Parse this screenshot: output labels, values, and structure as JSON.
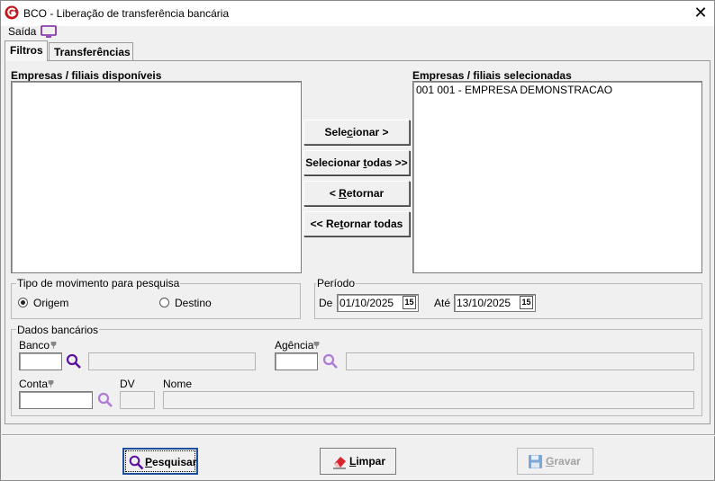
{
  "window": {
    "title": "BCO - Liberação de transferência bancária"
  },
  "menu": {
    "saida_label": "Saída"
  },
  "tabs": [
    {
      "label": "Filtros",
      "active": true
    },
    {
      "label": "Transferências",
      "active": false
    }
  ],
  "filtros": {
    "disponiveis_label": "Empresas / filiais disponíveis",
    "disponiveis_items": [],
    "selecionadas_label": "Empresas / filiais selecionadas",
    "selecionadas_items": [
      "001 001 - EMPRESA DEMONSTRACAO"
    ],
    "buttons": {
      "selecionar_pre": "Sele",
      "selecionar_u": "c",
      "selecionar_post": "ionar >",
      "selecionar_todas_pre": "Selecionar ",
      "selecionar_todas_u": "t",
      "selecionar_todas_post": "odas >>",
      "retornar_pre": "< ",
      "retornar_u": "R",
      "retornar_post": "etornar",
      "retornar_todas_pre": "<< Re",
      "retornar_todas_u": "t",
      "retornar_todas_post": "ornar todas"
    },
    "tipo_movimento": {
      "title": "Tipo de movimento para pesquisa",
      "origem_label": "Origem",
      "destino_label": "Destino",
      "selected": "Origem"
    },
    "periodo": {
      "title": "Período",
      "de_label": "De",
      "de_value": "01/10/2025",
      "ate_label": "Até",
      "ate_value": "13/10/2025",
      "calendar_glyph": "15"
    },
    "dados_bancarios": {
      "title": "Dados bancários",
      "banco_label": "Banco",
      "banco_value": "",
      "banco_desc": "",
      "agencia_label": "Agência",
      "agencia_value": "",
      "agencia_desc": "",
      "conta_label": "Conta",
      "conta_value": "",
      "dv_label": "DV",
      "dv_value": "",
      "nome_label": "Nome",
      "nome_value": ""
    }
  },
  "footer": {
    "pesquisar_u": "P",
    "pesquisar_post": "esquisar",
    "limpar_u": "L",
    "limpar_post": "impar",
    "gravar_u": "G",
    "gravar_post": "ravar"
  },
  "colors": {
    "logo": "#c4161c",
    "menu_icon": "#7a1fa2",
    "search_active": "#5b0fa0",
    "search_disabled": "#b07ad9",
    "default_border": "#1e4f9c"
  }
}
